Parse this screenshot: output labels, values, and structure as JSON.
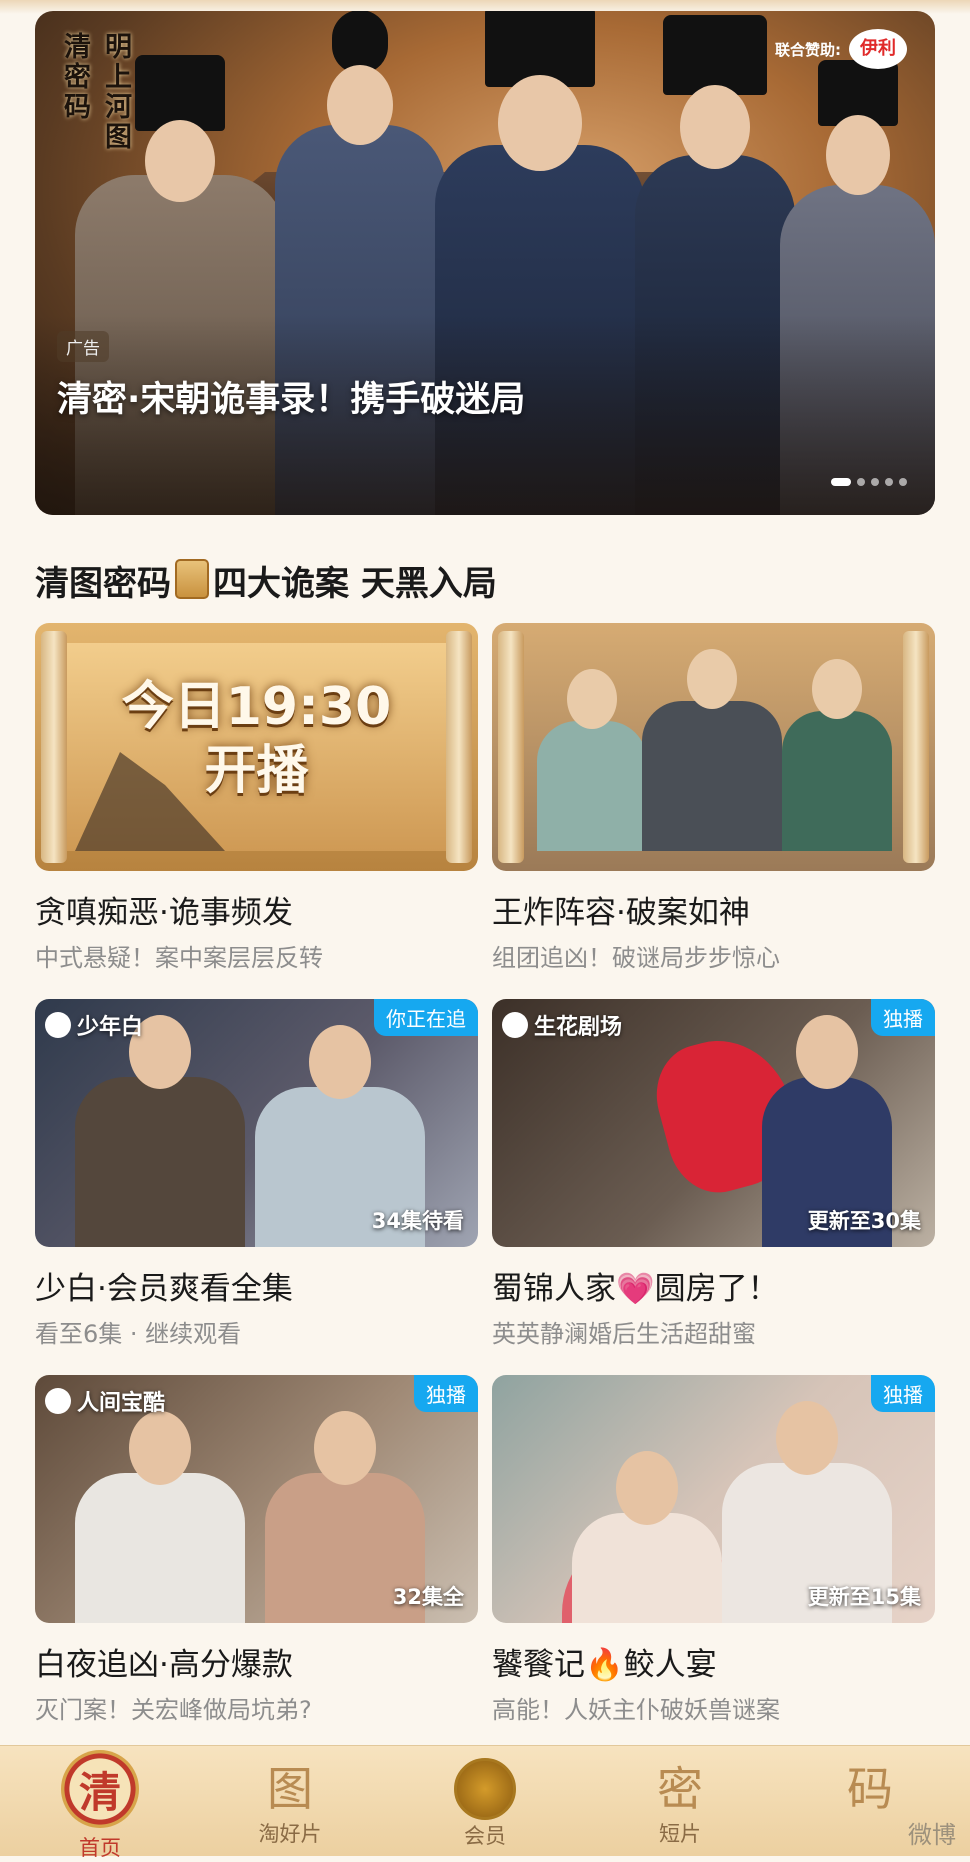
{
  "banner": {
    "logo_chars": [
      "密",
      "上",
      "码",
      "河",
      "图",
      "清",
      "明"
    ],
    "sponsor_label": "联合赞助:",
    "sponsor_logo_text": "伊利",
    "ad_tag": "广告",
    "title": "清密·宋朝诡事录！携手破迷局",
    "page_dots": 5
  },
  "section": {
    "title_part1": "清图密码",
    "title_part2": "四大诡案 天黑入局",
    "emoji_icon": "scroll-icon"
  },
  "cards": [
    {
      "title": "贪嗔痴恶·诡事频发",
      "subtitle": "中式悬疑！案中案层层反转",
      "overlay_text": "今日19:30\n开播"
    },
    {
      "title": "王炸阵容·破案如神",
      "subtitle": "组团追凶！破谜局步步惊心"
    },
    {
      "title": "少白·会员爽看全集",
      "subtitle": "看至6集 · 继续观看",
      "badge": "你正在追",
      "count": "34集待看",
      "brand": "少年白"
    },
    {
      "title": "蜀锦人家💗圆房了！",
      "subtitle": "英英静澜婚后生活超甜蜜",
      "badge": "独播",
      "count": "更新至30集",
      "brand": "生花剧场"
    },
    {
      "title": "白夜追凶·高分爆款",
      "subtitle": "灭门案！关宏峰做局坑弟?",
      "badge": "独播",
      "count": "32集全",
      "brand": "人间宝酷"
    },
    {
      "title": "饕餮记🔥鲛人宴",
      "subtitle": "高能！人妖主仆破妖兽谜案",
      "badge": "独播",
      "count": "更新至15集"
    }
  ],
  "nav": {
    "items": [
      {
        "glyph": "清",
        "label": "首页"
      },
      {
        "glyph": "图",
        "label": "淘好片"
      },
      {
        "glyph": "",
        "label": "会员"
      },
      {
        "glyph": "密",
        "label": "短片"
      },
      {
        "glyph": "码",
        "label": ""
      }
    ]
  },
  "watermark": "微博"
}
